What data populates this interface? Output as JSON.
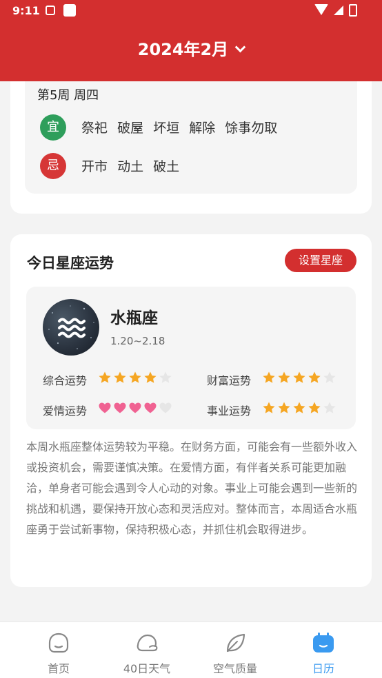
{
  "status_bar": {
    "time": "9:11"
  },
  "header": {
    "title": "2024年2月"
  },
  "almanac": {
    "week_line": "第5周  周四",
    "yi": {
      "badge": "宜",
      "items": [
        "祭祀",
        "破屋",
        "坏垣",
        "解除",
        "馀事勿取"
      ]
    },
    "ji": {
      "badge": "忌",
      "items": [
        "开市",
        "动土",
        "破土"
      ]
    }
  },
  "horoscope": {
    "title": "今日星座运势",
    "set_button": "设置星座",
    "sign_name": "水瓶座",
    "sign_dates": "1.20~2.18",
    "fortunes": [
      {
        "label": "综合运势",
        "rating": 4,
        "max": 5,
        "icon": "star-icon"
      },
      {
        "label": "财富运势",
        "rating": 4,
        "max": 5,
        "icon": "star-icon"
      },
      {
        "label": "爱情运势",
        "rating": 4,
        "max": 5,
        "icon": "heart-icon"
      },
      {
        "label": "事业运势",
        "rating": 4,
        "max": 5,
        "icon": "star-icon"
      }
    ],
    "description": "本周水瓶座整体运势较为平稳。在财务方面，可能会有一些额外收入或投资机会，需要谨慎决策。在爱情方面，有伴者关系可能更加融洽，单身者可能会遇到令人心动的对象。事业上可能会遇到一些新的挑战和机遇，要保持开放心态和灵活应对。整体而言，本周适合水瓶座勇于尝试新事物，保持积极心态，并抓住机会取得进步。"
  },
  "bottom_nav": [
    {
      "label": "首页",
      "icon": "home-face-icon",
      "active": false
    },
    {
      "label": "40日天气",
      "icon": "cloud-icon",
      "active": false
    },
    {
      "label": "空气质量",
      "icon": "leaf-icon",
      "active": false
    },
    {
      "label": "日历",
      "icon": "calendar-icon",
      "active": true
    }
  ],
  "colors": {
    "brand_red": "#d32f2f",
    "yi_green": "#2e9e5b",
    "ji_red": "#d63636",
    "active_blue": "#3a9af0",
    "star_orange": "#f5a623",
    "heart_pink": "#f06292"
  }
}
